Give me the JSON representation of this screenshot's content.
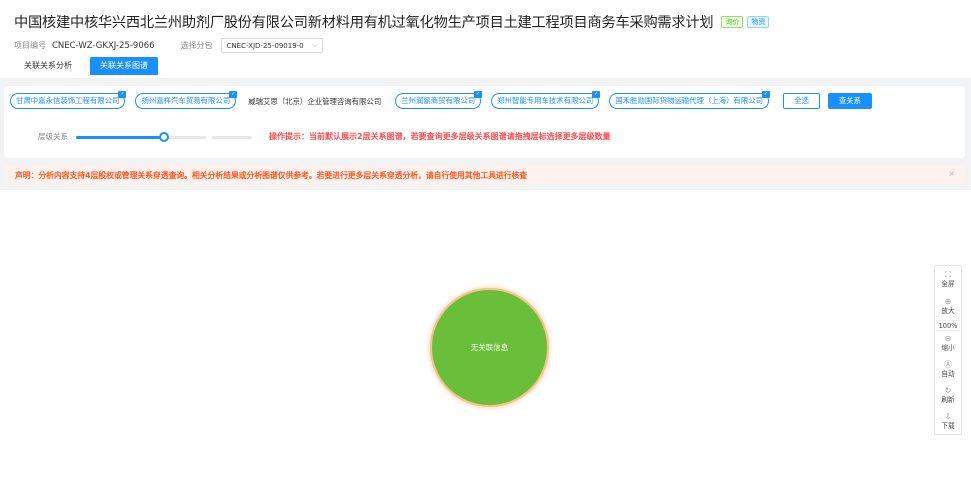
{
  "header": {
    "title": "中国核建中核华兴西北兰州助剂厂股份有限公司新材料用有机过氧化物生产项目土建工程项目商务车采购需求计划",
    "tags": [
      "询价",
      "物资"
    ],
    "project_no_label": "项目编号",
    "project_no": "CNEC-WZ-GKXJ-25-9066",
    "branch_label": "选择分包",
    "branch_value": "CNEC-XJD-25-09019-0",
    "tabs": [
      "关联关系分析",
      "关联关系图谱"
    ]
  },
  "companies": {
    "chips": [
      "甘肃中嘉永信装饰工程有限公司",
      "扬州嘉祥汽车贸易有限公司"
    ],
    "plain": "威瑞艾思（北京）企业管理咨询有限公司",
    "chips2": [
      "兰州润丽商贸有限公司",
      "郑州智能专用车技术有限公司",
      "国禾胜勋国际货物运输代理（上海）有限公司"
    ],
    "select_all": "全选",
    "query": "查关系"
  },
  "level": {
    "label": "层级关系",
    "value_fraction": 0.5,
    "tip": "操作提示：当前默认展示2层关系图谱，若要查询更多层级关系图谱请拖拽层标选择更多层级数量"
  },
  "notice": {
    "text": "声明：分析内容支持4层股权或管理关系穿透查询。相关分析结果或分析图谱仅供参考。若要进行更多层关系穿透分析，请自行使用其他工具进行核查",
    "close": "×"
  },
  "graph": {
    "node_label": "无关联信息",
    "node_color": "#6abf3a"
  },
  "toolbar": {
    "fullscreen": "全屏",
    "zoom_in": "放大",
    "zoom": "100%",
    "zoom_out": "缩小",
    "auto": "自动",
    "refresh": "刷新",
    "download": "下载"
  }
}
